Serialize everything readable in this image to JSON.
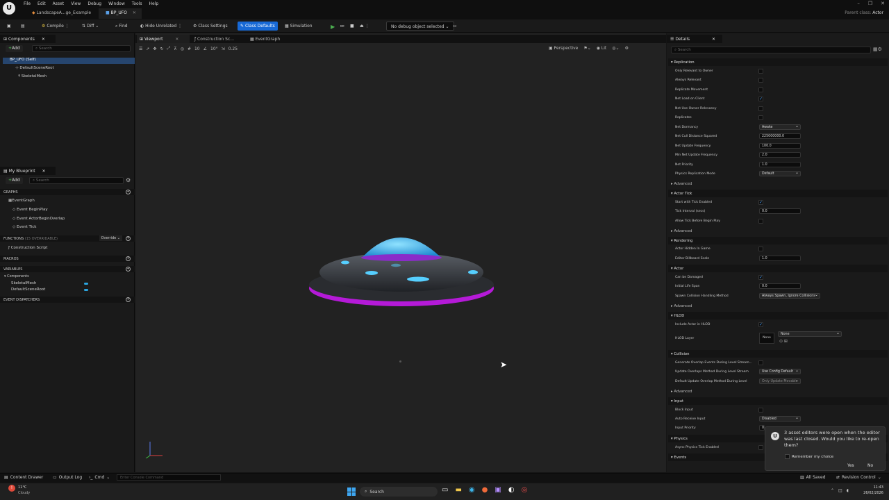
{
  "menu": {
    "items": [
      "File",
      "Edit",
      "Asset",
      "View",
      "Debug",
      "Window",
      "Tools",
      "Help"
    ],
    "parent_class_label": "Parent class:",
    "parent_class_value": "Actor"
  },
  "tabs": [
    {
      "label": "LandscapeA...ge_Example"
    },
    {
      "label": "BP_UFO"
    }
  ],
  "toolbar": {
    "compile": "Compile",
    "diff": "Diff",
    "find": "Find",
    "hide_unrelated": "Hide Unrelated",
    "class_settings": "Class Settings",
    "class_defaults": "Class Defaults",
    "simulation": "Simulation",
    "debug_object": "No debug object selected"
  },
  "components_panel": {
    "title": "Components",
    "add": "Add",
    "search_placeholder": "Search",
    "items": [
      "BP_UFO (Self)",
      "DefaultSceneRoot",
      "SkeletalMesh"
    ]
  },
  "blueprint_panel": {
    "title": "My Blueprint",
    "add": "Add",
    "search_placeholder": "Search",
    "graphs_label": "GRAPHS",
    "event_graph": "EventGraph",
    "events": [
      "Event BeginPlay",
      "Event ActorBeginOverlap",
      "Event Tick"
    ],
    "functions_label": "FUNCTIONS",
    "functions_count": "(15 OVERRIDABLE)",
    "override_label": "Override",
    "construction_script": "Construction Script",
    "macros_label": "MACROS",
    "variables_label": "VARIABLES",
    "components_label": "Components",
    "variables": [
      "SkeletalMesh",
      "DefaultSceneRoot"
    ],
    "dispatchers_label": "EVENT DISPATCHERS"
  },
  "center_tabs": [
    "Viewport",
    "Construction Sc...",
    "EventGraph"
  ],
  "viewport_toolbar": {
    "snap_angle": "10°",
    "scale_snap": "0.25",
    "grid_snap": "10",
    "perspective": "Perspective",
    "lit": "Lit"
  },
  "details": {
    "title": "Details",
    "search_placeholder": "Search",
    "sections": {
      "replication": "Replication",
      "actor_tick": "Actor Tick",
      "rendering": "Rendering",
      "actor": "Actor",
      "hlod": "HLOD",
      "collision": "Collision",
      "input": "Input",
      "physics": "Physics",
      "events": "Events",
      "advanced": "Advanced"
    },
    "replication_rows": {
      "only_relevant_to_owner": "Only Relevant to Owner",
      "always_relevant": "Always Relevant",
      "replicate_movement": "Replicate Movement",
      "net_load_on_client": "Net Load on Client",
      "net_use_owner_relevancy": "Net Use Owner Relevancy",
      "replicates": "Replicates",
      "net_dormancy": "Net Dormancy",
      "net_dormancy_value": "Awake",
      "net_cull_distance": "Net Cull Distance Squared",
      "net_cull_distance_value": "225000000.0",
      "net_update_frequency": "Net Update Frequency",
      "net_update_frequency_value": "100.0",
      "min_net_update_frequency": "Min Net Update Frequency",
      "min_net_update_frequency_value": "2.0",
      "net_priority": "Net Priority",
      "net_priority_value": "1.0",
      "physics_replication_mode": "Physics Replication Mode",
      "physics_replication_mode_value": "Default"
    },
    "tick_rows": {
      "start_with_tick_enabled": "Start with Tick Enabled",
      "tick_interval": "Tick Interval (secs)",
      "tick_interval_value": "0.0",
      "allow_tick_before_begin_play": "Allow Tick Before Begin Play"
    },
    "rendering_rows": {
      "actor_hidden_in_game": "Actor Hidden In Game",
      "editor_billboard_scale": "Editor Billboard Scale",
      "editor_billboard_scale_value": "1.0"
    },
    "actor_rows": {
      "can_be_damaged": "Can be Damaged",
      "initial_life_span": "Initial Life Span",
      "initial_life_span_value": "0.0",
      "spawn_collision": "Spawn Collision Handling Method",
      "spawn_collision_value": "Always Spawn, Ignore Collisions"
    },
    "hlod_rows": {
      "include_actor_in_hlod": "Include Actor in HLOD",
      "hlod_layer": "HLOD Layer",
      "hlod_layer_value": "None",
      "hlod_thumb": "None"
    },
    "collision_rows": {
      "generate_overlap_events": "Generate Overlap Events During Level Stream...",
      "update_overlaps_method": "Update Overlaps Method During Level Stream",
      "update_overlaps_value": "Use Config Default",
      "default_update_overlap": "Default Update Overlap Method During Level",
      "default_update_overlap_value": "Only Update Movable"
    },
    "input_rows": {
      "block_input": "Block Input",
      "auto_receive_input": "Auto Receive Input",
      "auto_receive_input_value": "Disabled",
      "input_priority": "Input Priority",
      "input_priority_value": "0"
    },
    "physics_rows": {
      "async_physics_tick": "Async Physics Tick Enabled"
    }
  },
  "notification": {
    "message": "3 asset editors were open when the editor was last closed. Would you like to re-open them?",
    "remember": "Remember my choice",
    "yes": "Yes",
    "no": "No"
  },
  "statusbar": {
    "content_drawer": "Content Drawer",
    "output_log": "Output Log",
    "cmd": "Cmd",
    "console_placeholder": "Enter Console Command",
    "all_saved": "All Saved",
    "revision_control": "Revision Control"
  },
  "taskbar": {
    "weather_temp": "11°C",
    "weather_desc": "Cloudy",
    "search": "Search",
    "time": "11:43",
    "date": "26/02/2026"
  }
}
